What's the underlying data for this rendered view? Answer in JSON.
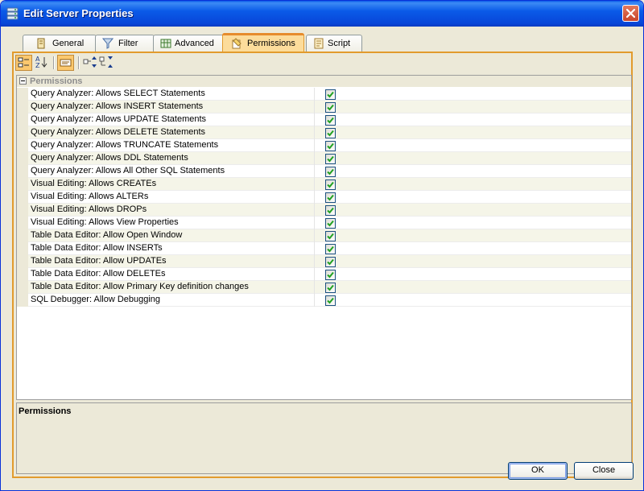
{
  "window": {
    "title": "Edit Server Properties",
    "close_symbol": "✕"
  },
  "tabs": [
    {
      "label": "General",
      "icon": "general-icon"
    },
    {
      "label": "Filter",
      "icon": "filter-icon"
    },
    {
      "label": "Advanced",
      "icon": "advanced-icon"
    },
    {
      "label": "Permissions",
      "icon": "permissions-icon",
      "active": true
    },
    {
      "label": "Script",
      "icon": "script-icon"
    }
  ],
  "toolbar": {
    "buttons": [
      "categorized-icon",
      "alphabetical-icon",
      "property-pages-icon",
      "expand-all-icon",
      "collapse-all-icon"
    ]
  },
  "grid": {
    "category": "Permissions",
    "rows": [
      {
        "label": "Query Analyzer: Allows SELECT Statements",
        "checked": true
      },
      {
        "label": "Query Analyzer: Allows INSERT Statements",
        "checked": true
      },
      {
        "label": "Query Analyzer: Allows UPDATE Statements",
        "checked": true
      },
      {
        "label": "Query Analyzer: Allows DELETE Statements",
        "checked": true
      },
      {
        "label": "Query Analyzer: Allows TRUNCATE Statements",
        "checked": true
      },
      {
        "label": "Query Analyzer: Allows DDL Statements",
        "checked": true
      },
      {
        "label": "Query Analyzer: Allows All Other SQL Statements",
        "checked": true
      },
      {
        "label": "Visual Editing: Allows CREATEs",
        "checked": true
      },
      {
        "label": "Visual Editing: Allows ALTERs",
        "checked": true
      },
      {
        "label": "Visual Editing: Allows DROPs",
        "checked": true
      },
      {
        "label": "Visual Editing: Allows View Properties",
        "checked": true
      },
      {
        "label": "Table Data Editor: Allow Open Window",
        "checked": true
      },
      {
        "label": "Table Data Editor: Allow INSERTs",
        "checked": true
      },
      {
        "label": "Table Data Editor: Allow UPDATEs",
        "checked": true
      },
      {
        "label": "Table Data Editor: Allow DELETEs",
        "checked": true
      },
      {
        "label": "Table Data Editor: Allow Primary Key definition changes",
        "checked": true
      },
      {
        "label": "SQL Debugger: Allow Debugging",
        "checked": true
      }
    ]
  },
  "description": {
    "title": "Permissions",
    "text": ""
  },
  "buttons": {
    "ok": "OK",
    "close": "Close"
  },
  "colors": {
    "title_bar": "#0a5ae8",
    "active_tab": "#fcdc9b",
    "panel_border": "#e29b2d",
    "check_mark": "#21a121"
  }
}
